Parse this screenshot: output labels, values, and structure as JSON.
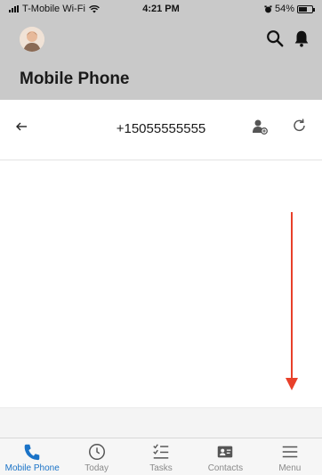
{
  "status_bar": {
    "carrier": "T-Mobile Wi-Fi",
    "time": "4:21 PM",
    "battery": "54%",
    "battery_level": 0.54
  },
  "header": {
    "title": "Mobile Phone",
    "icons": [
      "avatar",
      "search-icon",
      "bell-icon"
    ]
  },
  "call_bar": {
    "phone_number": "+15055555555",
    "icons": [
      "back-arrow-icon",
      "add-contact-icon",
      "refresh-icon"
    ]
  },
  "tabs": [
    {
      "label": "Mobile Phone",
      "icon": "phone-icon",
      "active": true
    },
    {
      "label": "Today",
      "icon": "clock-icon",
      "active": false
    },
    {
      "label": "Tasks",
      "icon": "tasks-icon",
      "active": false
    },
    {
      "label": "Contacts",
      "icon": "contact-card-icon",
      "active": false
    },
    {
      "label": "Menu",
      "icon": "hamburger-icon",
      "active": false
    }
  ],
  "colors": {
    "header_bg": "#c9c9c9",
    "active_tab": "#1a73c7",
    "inactive_tab": "#8a8a8a",
    "scroll_arrow": "#e8402a"
  }
}
